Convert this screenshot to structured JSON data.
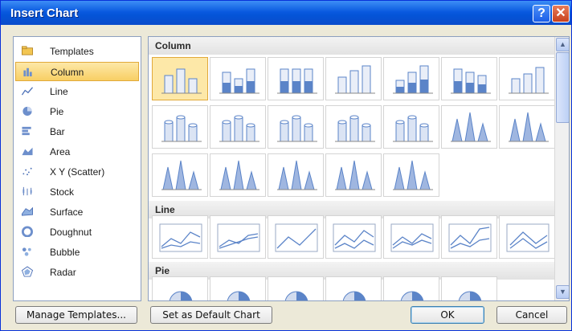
{
  "window": {
    "title": "Insert Chart"
  },
  "chart_types": [
    {
      "label": "Templates",
      "icon": "folder-icon",
      "selected": false
    },
    {
      "label": "Column",
      "icon": "column-chart-icon",
      "selected": true
    },
    {
      "label": "Line",
      "icon": "line-chart-icon",
      "selected": false
    },
    {
      "label": "Pie",
      "icon": "pie-chart-icon",
      "selected": false
    },
    {
      "label": "Bar",
      "icon": "bar-chart-icon",
      "selected": false
    },
    {
      "label": "Area",
      "icon": "area-chart-icon",
      "selected": false
    },
    {
      "label": "X Y (Scatter)",
      "icon": "scatter-chart-icon",
      "selected": false
    },
    {
      "label": "Stock",
      "icon": "stock-chart-icon",
      "selected": false
    },
    {
      "label": "Surface",
      "icon": "surface-chart-icon",
      "selected": false
    },
    {
      "label": "Doughnut",
      "icon": "doughnut-chart-icon",
      "selected": false
    },
    {
      "label": "Bubble",
      "icon": "bubble-chart-icon",
      "selected": false
    },
    {
      "label": "Radar",
      "icon": "radar-chart-icon",
      "selected": false
    }
  ],
  "sections": {
    "column": {
      "title": "Column",
      "count": 19,
      "selected_index": 0
    },
    "line": {
      "title": "Line",
      "count": 7
    },
    "pie": {
      "title": "Pie",
      "count": 6
    }
  },
  "buttons": {
    "manage_templates": "Manage Templates...",
    "set_default": "Set as Default Chart",
    "ok": "OK",
    "cancel": "Cancel"
  },
  "colors": {
    "titlebar": "#0a5ae0",
    "selection": "#fde8a8",
    "chart_blue": "#5b84c8"
  }
}
